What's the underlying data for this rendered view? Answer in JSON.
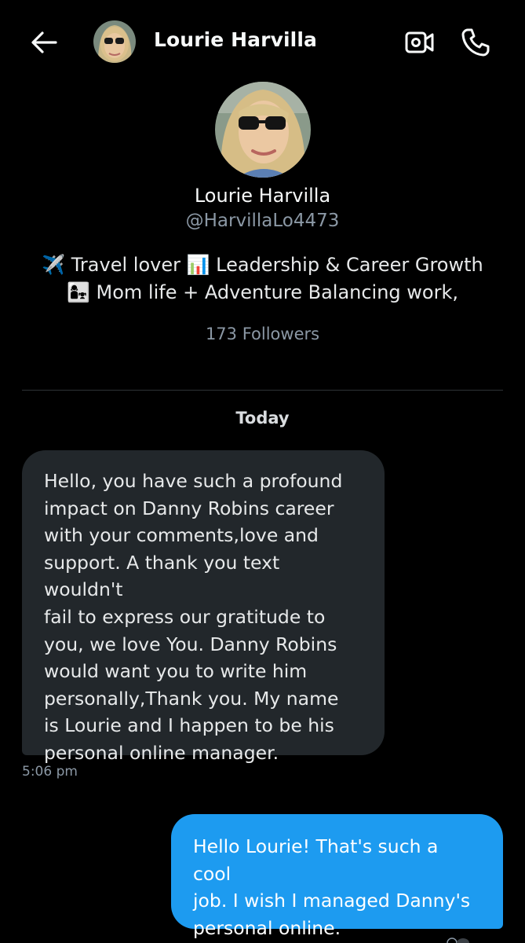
{
  "header": {
    "title": "Lourie Harvilla",
    "back_icon": "arrow-left-icon",
    "video_icon": "video-call-icon",
    "call_icon": "phone-icon"
  },
  "profile": {
    "name": "Lourie Harvilla",
    "handle": "@HarvillaLo4473",
    "bio_line1_emoji1": "✈️",
    "bio_line1_text1": "Travel lover",
    "bio_line1_emoji2": "📊",
    "bio_line1_text2": "Leadership & Career Growth",
    "bio_line2_emoji": "👩‍👧",
    "bio_line2_text": "Mom life + Adventure  Balancing work,",
    "followers": "173 Followers"
  },
  "conversation": {
    "date_separator": "Today",
    "messages": [
      {
        "direction": "incoming",
        "lines": [
          "Hello, you have such a profound",
          "impact on Danny Robins career",
          "with your comments,love and",
          "support. A thank you text wouldn't",
          "fail to express our gratitude to",
          "you, we love You. Danny Robins",
          "would want you to write him",
          "personally,Thank you. My name",
          "is Lourie and I happen to be his",
          "personal online manager."
        ],
        "time": "5:06 pm"
      },
      {
        "direction": "outgoing",
        "lines": [
          "Hello Lourie! That's such a cool",
          "job. I wish I managed Danny's",
          "personal online."
        ]
      }
    ]
  },
  "colors": {
    "background": "#000000",
    "incoming_bubble": "#22272b",
    "outgoing_bubble": "#1d9bf0",
    "secondary_text": "#8b98a5"
  }
}
